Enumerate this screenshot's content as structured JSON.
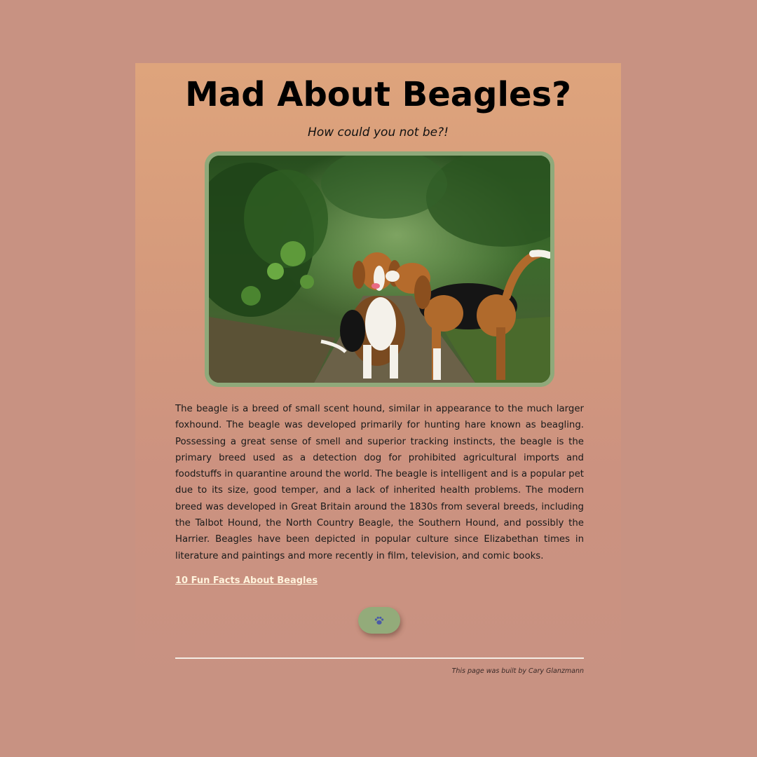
{
  "page": {
    "title": "Mad About Beagles?",
    "subtitle": "How could you not be?!",
    "image": {
      "subject": "two-beagles-on-forest-path",
      "frame_color": "#8fa97a"
    },
    "body": "The beagle is a breed of small scent hound, similar in appearance to the much larger foxhound. The beagle was developed primarily for hunting hare known as beagling. Possessing a great sense of smell and superior tracking instincts, the beagle is the primary breed used as a detection dog for prohibited agricultural imports and foodstuffs in quarantine around the world. The beagle is intelligent and is a popular pet due to its size, good temper, and a lack of inherited health problems. The modern breed was developed in Great Britain around the 1830s from several breeds, including the Talbot Hound, the North Country Beagle, the Southern Hound, and possibly the Harrier. Beagles have been depicted in popular culture since Elizabethan times in literature and paintings and more recently in film, television, and comic books.",
    "link_label": "10 Fun Facts About Beagles",
    "button": {
      "icon": "paw-icon",
      "color": "#93ab7a"
    },
    "footer": {
      "credit": "This page was built by Cary Glanzmann"
    }
  },
  "colors": {
    "background": "#c89282",
    "card_top": "#dea47c",
    "link": "#fff3dc",
    "divider": "#f4ede4"
  }
}
